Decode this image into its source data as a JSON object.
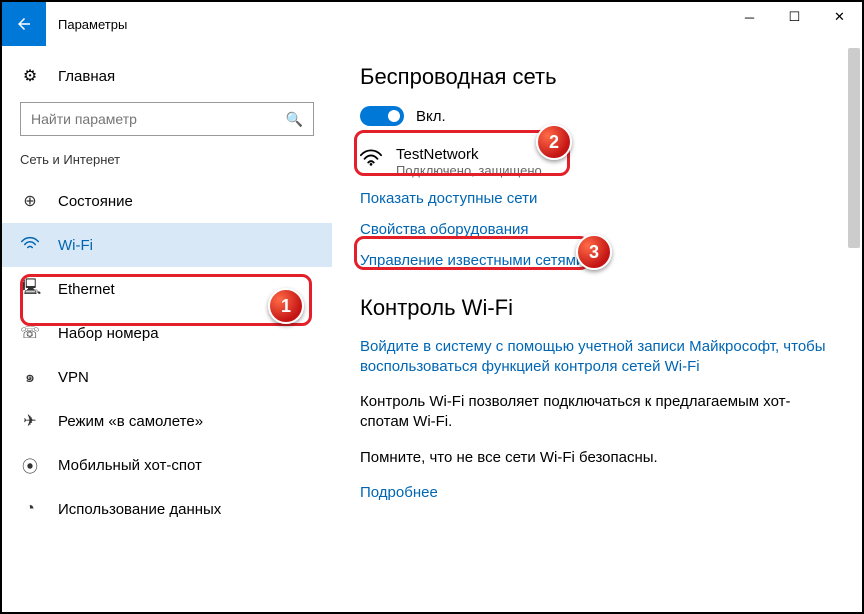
{
  "titlebar": {
    "title": "Параметры"
  },
  "sidebar": {
    "home": "Главная",
    "search_placeholder": "Найти параметр",
    "category": "Сеть и Интернет",
    "items": [
      {
        "label": "Состояние",
        "icon": "🌐"
      },
      {
        "label": "Wi-Fi",
        "icon": "⚡"
      },
      {
        "label": "Ethernet",
        "icon": "🖥"
      },
      {
        "label": "Набор номера",
        "icon": "📞"
      },
      {
        "label": "VPN",
        "icon": "🔒"
      },
      {
        "label": "Режим «в самолете»",
        "icon": "✈"
      },
      {
        "label": "Мобильный хот-спот",
        "icon": "📶"
      },
      {
        "label": "Использование данных",
        "icon": "📊"
      }
    ]
  },
  "main": {
    "heading1": "Беспроводная сеть",
    "toggle_state": "Вкл.",
    "network": {
      "name": "TestNetwork",
      "status": "Подключено, защищено"
    },
    "links": {
      "show_available": "Показать доступные сети",
      "hardware_props": "Свойства оборудования",
      "manage_known": "Управление известными сетями",
      "signin": "Войдите в систему с помощью учетной записи Майкрософт, чтобы воспользоваться функцией контроля сетей Wi-Fi",
      "more": "Подробнее"
    },
    "heading2": "Контроль Wi-Fi",
    "body1": "Контроль Wi-Fi позволяет подключаться к предлагаемым хот-спотам Wi-Fi.",
    "body2": "Помните, что не все сети Wi-Fi безопасны."
  },
  "annotations": {
    "b1": "1",
    "b2": "2",
    "b3": "3"
  }
}
